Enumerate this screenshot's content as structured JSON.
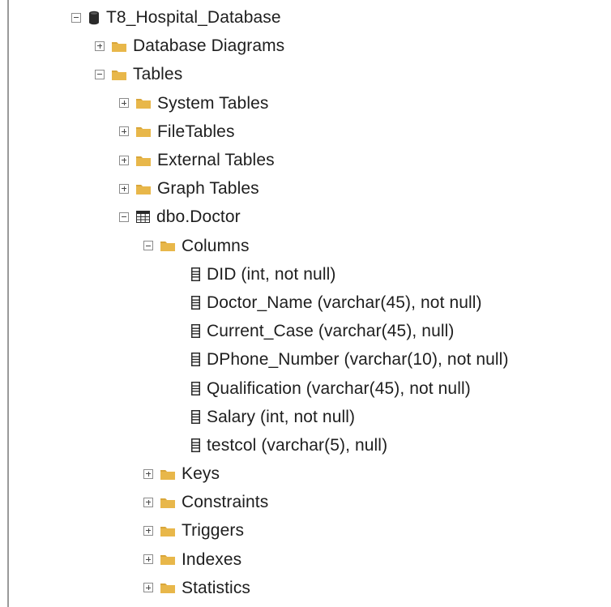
{
  "tree": {
    "database": {
      "label": "T8_Hospital_Database",
      "icon": "database-icon",
      "state": "expanded"
    },
    "database_diagrams": {
      "label": "Database Diagrams",
      "icon": "folder-icon",
      "state": "collapsed"
    },
    "tables": {
      "label": "Tables",
      "icon": "folder-icon",
      "state": "expanded",
      "children": [
        {
          "label": "System Tables",
          "icon": "folder-icon",
          "state": "collapsed"
        },
        {
          "label": "FileTables",
          "icon": "folder-icon",
          "state": "collapsed"
        },
        {
          "label": "External Tables",
          "icon": "folder-icon",
          "state": "collapsed"
        },
        {
          "label": "Graph Tables",
          "icon": "folder-icon",
          "state": "collapsed"
        }
      ]
    },
    "table": {
      "label": "dbo.Doctor",
      "icon": "table-icon",
      "state": "expanded"
    },
    "columns_folder": {
      "label": "Columns",
      "icon": "folder-icon",
      "state": "expanded",
      "items": [
        {
          "label": "DID (int, not null)",
          "icon": "column-icon"
        },
        {
          "label": "Doctor_Name (varchar(45), not null)",
          "icon": "column-icon"
        },
        {
          "label": "Current_Case (varchar(45), null)",
          "icon": "column-icon"
        },
        {
          "label": "DPhone_Number (varchar(10), not null)",
          "icon": "column-icon"
        },
        {
          "label": "Qualification (varchar(45), not null)",
          "icon": "column-icon"
        },
        {
          "label": "Salary (int, not null)",
          "icon": "column-icon"
        },
        {
          "label": "testcol (varchar(5), null)",
          "icon": "column-icon"
        }
      ]
    },
    "table_subfolders": [
      {
        "label": "Keys",
        "icon": "folder-icon",
        "state": "collapsed"
      },
      {
        "label": "Constraints",
        "icon": "folder-icon",
        "state": "collapsed"
      },
      {
        "label": "Triggers",
        "icon": "folder-icon",
        "state": "collapsed"
      },
      {
        "label": "Indexes",
        "icon": "folder-icon",
        "state": "collapsed"
      },
      {
        "label": "Statistics",
        "icon": "folder-icon",
        "state": "collapsed"
      }
    ]
  },
  "colors": {
    "folder": "#e8b74a",
    "folder_tab": "#d9a63a",
    "database": "#2b2b2b",
    "text": "#1e1e1e",
    "toggle_border": "#8c8c8c"
  }
}
